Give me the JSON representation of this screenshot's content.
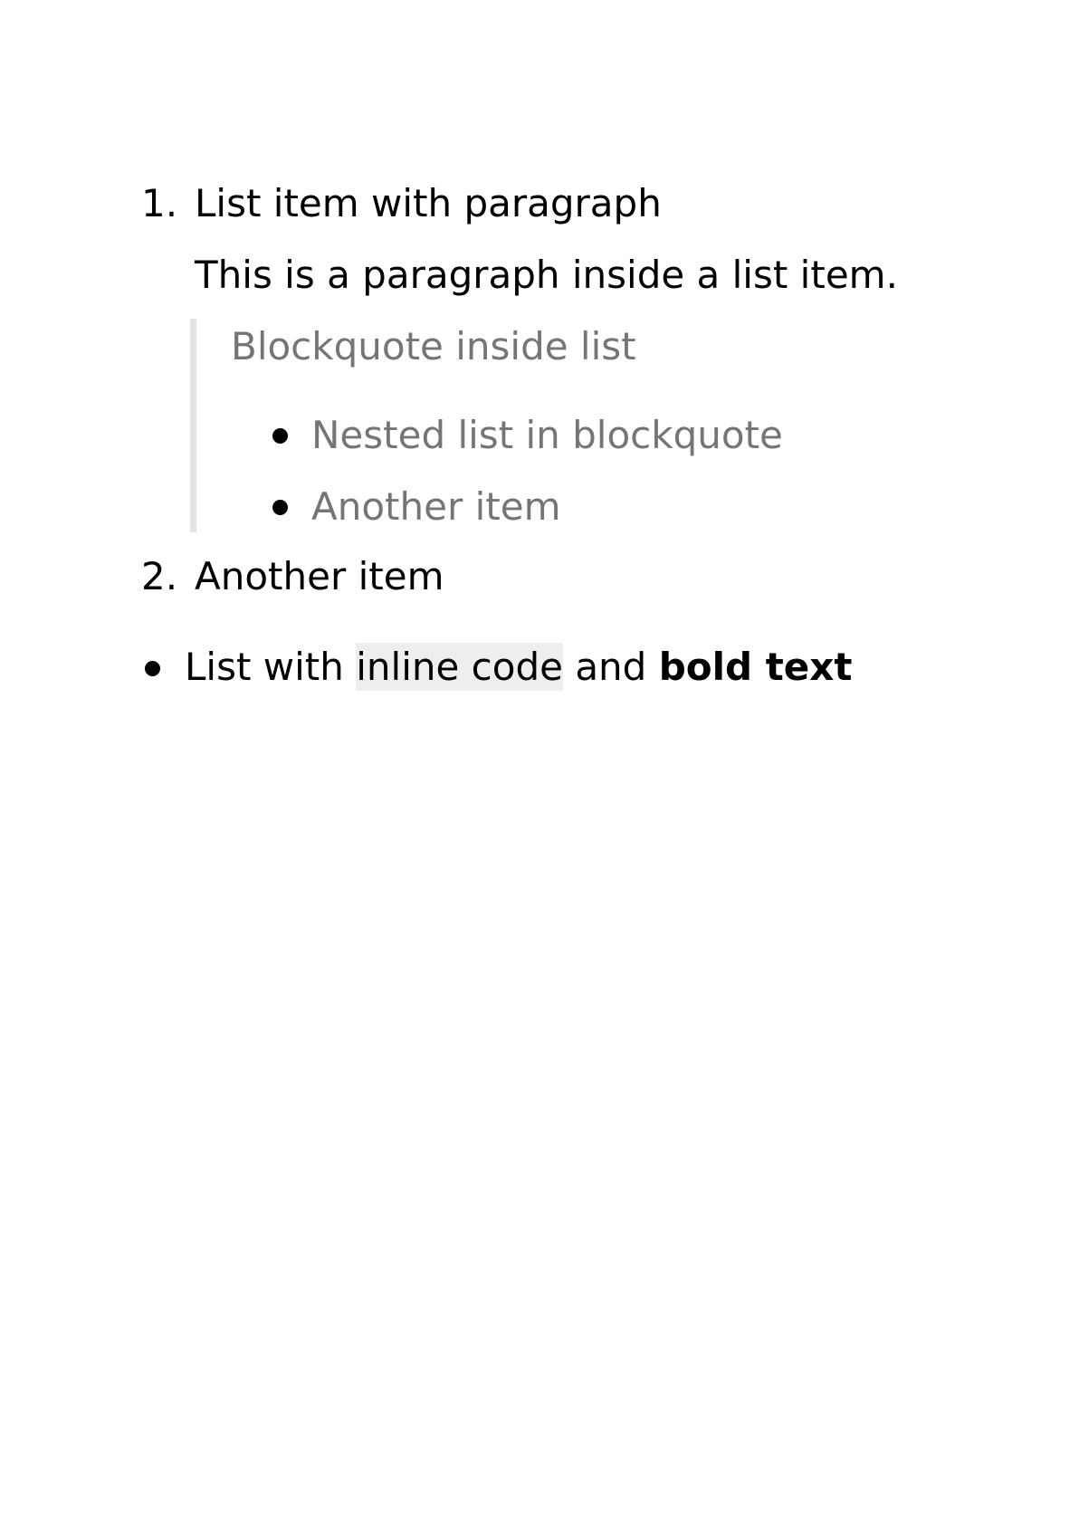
{
  "ordered_list": [
    {
      "marker": "1.",
      "title": "List item with paragraph",
      "paragraph": "This is a paragraph inside a list item.",
      "blockquote": {
        "text": "Blockquote inside list",
        "items": [
          "Nested list in blockquote",
          "Another item"
        ]
      }
    },
    {
      "marker": "2.",
      "title": "Another item"
    }
  ],
  "bullet_list": [
    {
      "text_before": "List with ",
      "code": "inline code",
      "text_middle": " and ",
      "bold": "bold text"
    }
  ]
}
